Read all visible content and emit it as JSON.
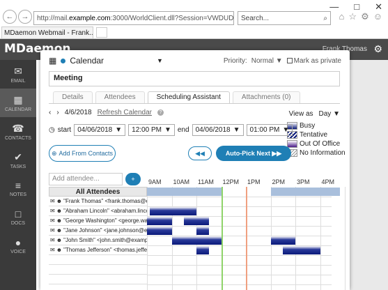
{
  "browser": {
    "url_prefix": "http://mail.",
    "url_domain": "example.com",
    "url_rest": ":3000/WorldClient.dll?Session=VWDUDA",
    "url_suffix": "☰ ☰ ☰",
    "search_placeholder": "Search...",
    "tab_title": "MDaemon Webmail - Frank...",
    "win_min": "—",
    "win_max": "□",
    "win_close": "✕",
    "back": "←",
    "fwd": "→"
  },
  "app": {
    "logo": "MDaemon",
    "user": "Frank Thomas"
  },
  "sidebar": {
    "items": [
      {
        "label": "EMAIL",
        "icon": "✉"
      },
      {
        "label": "CALENDAR",
        "icon": "▦"
      },
      {
        "label": "CONTACTS",
        "icon": "☎"
      },
      {
        "label": "TASKS",
        "icon": "✔"
      },
      {
        "label": "NOTES",
        "icon": "≡"
      },
      {
        "label": "DOCS",
        "icon": "□"
      },
      {
        "label": "VOICE",
        "icon": "●"
      }
    ]
  },
  "dialog": {
    "calendar": "Calendar",
    "priority_label": "Priority:",
    "priority_value": "Normal",
    "private_label": "Mark as private",
    "subject": "Meeting",
    "tabs": [
      "Details",
      "Attendees",
      "Scheduling Assistant",
      "Attachments (0)"
    ],
    "date": "4/6/2018",
    "refresh": "Refresh Calendar",
    "view_as_label": "View as",
    "view_as_value": "Day",
    "legend": [
      "Busy",
      "Tentative",
      "Out Of Office",
      "No Information"
    ],
    "start_label": "start",
    "start_date": "04/06/2018",
    "start_time": "12:00 PM",
    "end_label": "end",
    "end_date": "04/06/2018",
    "end_time": "01:00 PM",
    "add_contacts": "Add From Contacts",
    "auto_pick": "Auto-Pick Next",
    "add_attendee_placeholder": "Add attendee...",
    "all_attendees": "All Attendees",
    "hours": [
      "9AM",
      "10AM",
      "11AM",
      "12PM",
      "1PM",
      "2PM",
      "3PM",
      "4PM"
    ],
    "attendees": [
      "\"Frank Thomas\" <frank.thomas@example.com>",
      "\"Abraham Lincoln\" <abraham.lincoln@example.com>",
      "\"George Washington\" <george.washington@example.com>",
      "\"Jane Johnson\" <jane.johnson@example.com>",
      "\"John Smith\" <john.smith@example.com>",
      "\"Thomas Jefferson\" <thomas.jefferson@example.com>"
    ]
  }
}
